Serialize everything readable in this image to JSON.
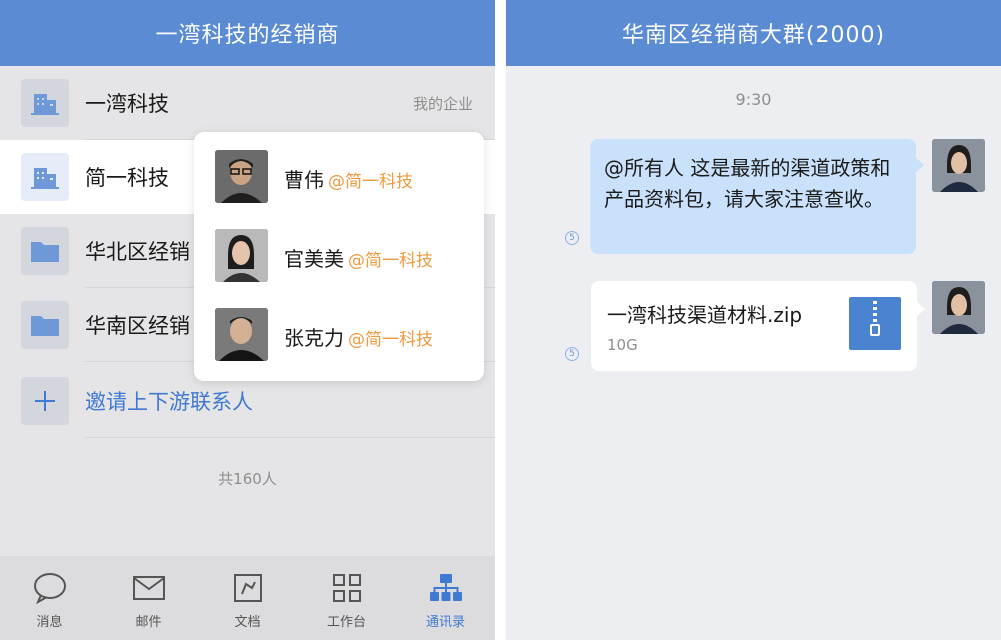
{
  "left": {
    "header_title": "一湾科技的经销商",
    "rows": [
      {
        "label": "一湾科技",
        "right": "我的企业",
        "icon": "building-icon"
      },
      {
        "label": "简一科技",
        "icon": "building-icon"
      },
      {
        "label": "华北区经销",
        "icon": "folder-icon"
      },
      {
        "label": "华南区经销",
        "icon": "folder-icon"
      },
      {
        "label": "邀请上下游联系人",
        "icon": "plus-icon"
      }
    ],
    "count_text": "共160人",
    "popup": [
      {
        "name": "曹伟",
        "org": "@简一科技"
      },
      {
        "name": "官美美",
        "org": "@简一科技"
      },
      {
        "name": "张克力",
        "org": "@简一科技"
      }
    ],
    "tabs": [
      {
        "label": "消息",
        "icon": "chat-bubble-icon",
        "active": false
      },
      {
        "label": "邮件",
        "icon": "mail-icon",
        "active": false
      },
      {
        "label": "文档",
        "icon": "document-icon",
        "active": false
      },
      {
        "label": "工作台",
        "icon": "grid-icon",
        "active": false
      },
      {
        "label": "通讯录",
        "icon": "org-chart-icon",
        "active": true
      }
    ]
  },
  "right": {
    "header_title": "华南区经销商大群(2000)",
    "time": "9:30",
    "message_text": "@所有人 这是最新的渠道政策和产品资料包，请大家注意查收。",
    "read_count_1": "5",
    "file": {
      "name": "一湾科技渠道材料.zip",
      "size": "10G",
      "icon": "zip-file-icon"
    },
    "read_count_2": "5"
  },
  "colors": {
    "header": "#5a8bd3",
    "accent": "#3f79d1",
    "org_orange": "#f09a3e",
    "bubble": "#c9e1fb"
  }
}
